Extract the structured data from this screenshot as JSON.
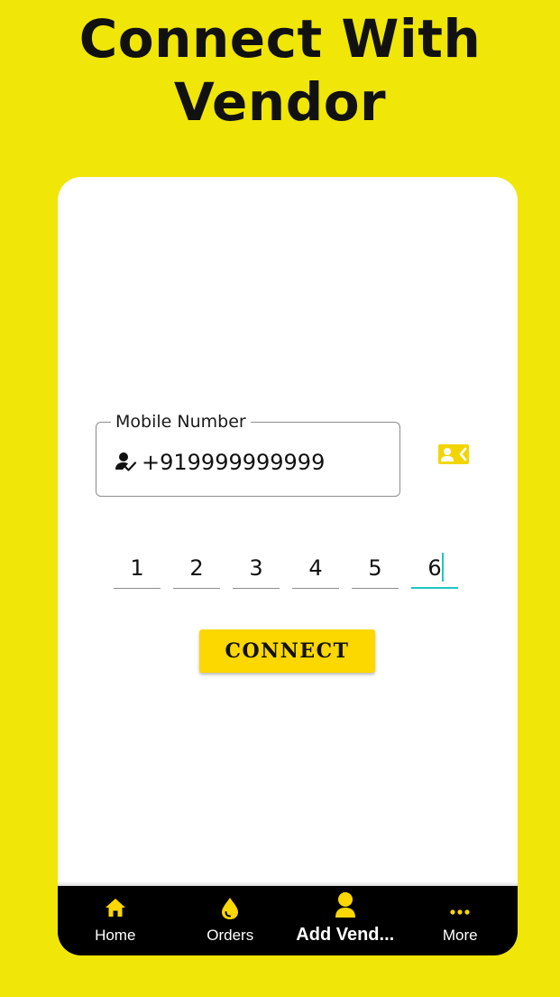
{
  "page": {
    "title_line1": "Connect With",
    "title_line2": "Vendor"
  },
  "form": {
    "mobile_label": "Mobile Number",
    "mobile_value": "+919999999999",
    "mobile_icon": "user-check-icon",
    "contact_icon": "contact-card-icon",
    "otp_digits": [
      "1",
      "2",
      "3",
      "4",
      "5",
      "6"
    ],
    "connect_label": "CONNECT"
  },
  "nav": {
    "items": [
      {
        "label": "Home",
        "icon": "home-icon"
      },
      {
        "label": "Orders",
        "icon": "drop-icon"
      },
      {
        "label": "Add Vend...",
        "icon": "person-icon",
        "selected": true
      },
      {
        "label": "More",
        "icon": "more-dots-icon"
      }
    ]
  },
  "colors": {
    "background": "#f0e607",
    "accent": "#fcd700",
    "cursor": "#1ec8c0",
    "nav_background": "#000000"
  }
}
